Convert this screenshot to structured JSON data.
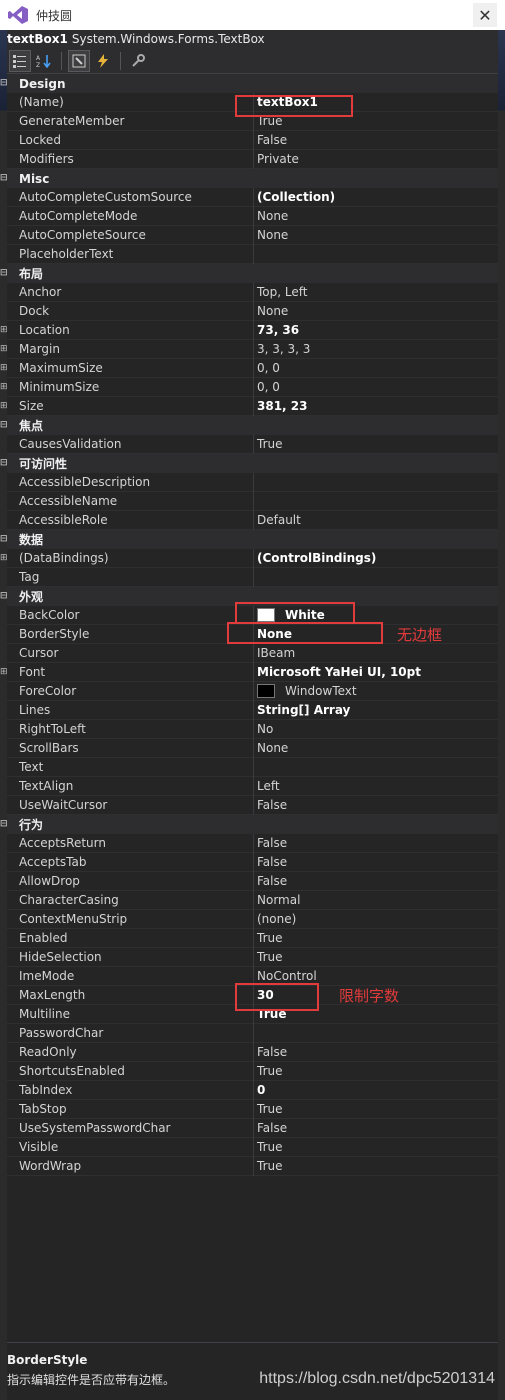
{
  "window": {
    "title": "仲技圆",
    "close_glyph": "✕"
  },
  "object": {
    "name": "textBox1",
    "type": "System.Windows.Forms.TextBox"
  },
  "toolbar": {
    "icons": [
      "categorized-icon",
      "alphabetical-icon",
      "properties-icon",
      "events-icon",
      "property-pages-icon"
    ]
  },
  "categories": [
    {
      "label": "Design",
      "rows": [
        {
          "name": "(Name)",
          "value": "textBox1",
          "bold": true
        },
        {
          "name": "GenerateMember",
          "value": "True"
        },
        {
          "name": "Locked",
          "value": "False"
        },
        {
          "name": "Modifiers",
          "value": "Private"
        }
      ]
    },
    {
      "label": "Misc",
      "rows": [
        {
          "name": "AutoCompleteCustomSource",
          "value": "(Collection)",
          "bold": true
        },
        {
          "name": "AutoCompleteMode",
          "value": "None"
        },
        {
          "name": "AutoCompleteSource",
          "value": "None"
        },
        {
          "name": "PlaceholderText",
          "value": ""
        }
      ]
    },
    {
      "label": "布局",
      "rows": [
        {
          "name": "Anchor",
          "value": "Top, Left"
        },
        {
          "name": "Dock",
          "value": "None"
        },
        {
          "name": "Location",
          "value": "73, 36",
          "bold": true,
          "expandable": true
        },
        {
          "name": "Margin",
          "value": "3, 3, 3, 3",
          "expandable": true
        },
        {
          "name": "MaximumSize",
          "value": "0, 0",
          "expandable": true
        },
        {
          "name": "MinimumSize",
          "value": "0, 0",
          "expandable": true
        },
        {
          "name": "Size",
          "value": "381, 23",
          "bold": true,
          "expandable": true
        }
      ]
    },
    {
      "label": "焦点",
      "rows": [
        {
          "name": "CausesValidation",
          "value": "True"
        }
      ]
    },
    {
      "label": "可访问性",
      "rows": [
        {
          "name": "AccessibleDescription",
          "value": ""
        },
        {
          "name": "AccessibleName",
          "value": ""
        },
        {
          "name": "AccessibleRole",
          "value": "Default"
        }
      ]
    },
    {
      "label": "数据",
      "rows": [
        {
          "name": "(DataBindings)",
          "value": "(ControlBindings)",
          "bold": true,
          "expandable": true
        },
        {
          "name": "Tag",
          "value": ""
        }
      ]
    },
    {
      "label": "外观",
      "rows": [
        {
          "name": "BackColor",
          "value": "White",
          "bold": true,
          "swatch": "#ffffff"
        },
        {
          "name": "BorderStyle",
          "value": "None",
          "bold": true
        },
        {
          "name": "Cursor",
          "value": "IBeam"
        },
        {
          "name": "Font",
          "value": "Microsoft YaHei UI, 10pt",
          "bold": true,
          "expandable": true
        },
        {
          "name": "ForeColor",
          "value": "WindowText",
          "swatch": "#000000"
        },
        {
          "name": "Lines",
          "value": "String[] Array",
          "bold": true
        },
        {
          "name": "RightToLeft",
          "value": "No"
        },
        {
          "name": "ScrollBars",
          "value": "None"
        },
        {
          "name": "Text",
          "value": ""
        },
        {
          "name": "TextAlign",
          "value": "Left"
        },
        {
          "name": "UseWaitCursor",
          "value": "False"
        }
      ]
    },
    {
      "label": "行为",
      "rows": [
        {
          "name": "AcceptsReturn",
          "value": "False"
        },
        {
          "name": "AcceptsTab",
          "value": "False"
        },
        {
          "name": "AllowDrop",
          "value": "False"
        },
        {
          "name": "CharacterCasing",
          "value": "Normal"
        },
        {
          "name": "ContextMenuStrip",
          "value": "(none)"
        },
        {
          "name": "Enabled",
          "value": "True"
        },
        {
          "name": "HideSelection",
          "value": "True"
        },
        {
          "name": "ImeMode",
          "value": "NoControl"
        },
        {
          "name": "MaxLength",
          "value": "30",
          "bold": true
        },
        {
          "name": "Multiline",
          "value": "True",
          "bold": true
        },
        {
          "name": "PasswordChar",
          "value": ""
        },
        {
          "name": "ReadOnly",
          "value": "False"
        },
        {
          "name": "ShortcutsEnabled",
          "value": "True"
        },
        {
          "name": "TabIndex",
          "value": "0",
          "bold": true
        },
        {
          "name": "TabStop",
          "value": "True"
        },
        {
          "name": "UseSystemPasswordChar",
          "value": "False"
        },
        {
          "name": "Visible",
          "value": "True"
        },
        {
          "name": "WordWrap",
          "value": "True"
        }
      ]
    }
  ],
  "annotations": {
    "border_note": "无边框",
    "maxlength_note": "限制字数",
    "color": "#e23b3b"
  },
  "description": {
    "title": "BorderStyle",
    "text": "指示编辑控件是否应带有边框。"
  },
  "watermark": "https://blog.csdn.net/dpc5201314"
}
